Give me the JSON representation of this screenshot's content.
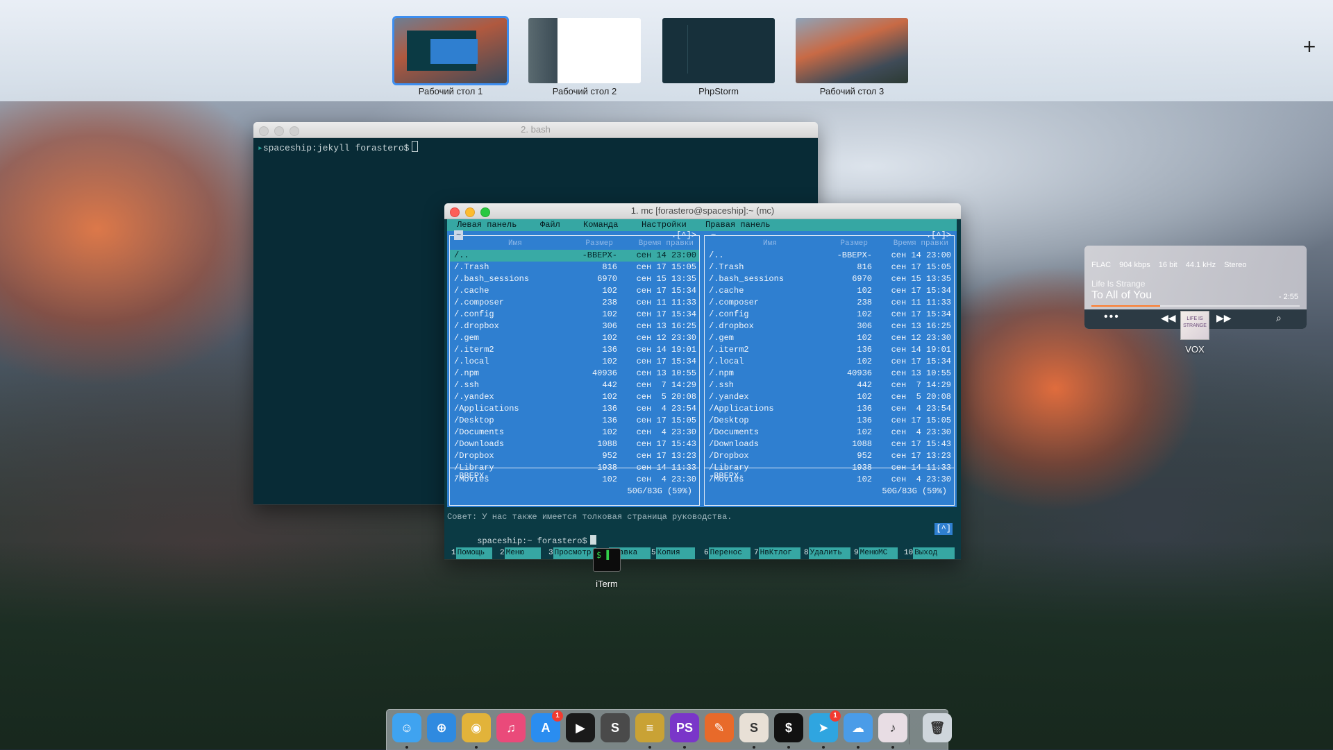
{
  "spaces": [
    {
      "label": "Рабочий стол 1",
      "active": true
    },
    {
      "label": "Рабочий стол 2",
      "active": false
    },
    {
      "label": "PhpStorm",
      "active": false
    },
    {
      "label": "Рабочий стол 3",
      "active": false
    }
  ],
  "add_space_label": "+",
  "bash_window": {
    "title": "2. bash",
    "prompt": "spaceship:jekyll forastero$"
  },
  "mc_window": {
    "title": "1. mc [forastero@spaceship]:~ (mc)",
    "menu": [
      "Левая панель",
      "Файл",
      "Команда",
      "Настройки",
      "Правая панель"
    ],
    "left_panel": {
      "path": "~",
      "header_right": ".[^]>",
      "columns": [
        "Имя",
        "Размер",
        "Время правки"
      ],
      "rows": [
        {
          "name": "/..",
          "size": "-ВВЕРХ-",
          "date": "сен 14 23:00",
          "selected": true
        },
        {
          "name": "/.Trash",
          "size": "816",
          "date": "сен 17 15:05"
        },
        {
          "name": "/.bash_sessions",
          "size": "6970",
          "date": "сен 15 13:35"
        },
        {
          "name": "/.cache",
          "size": "102",
          "date": "сен 17 15:34"
        },
        {
          "name": "/.composer",
          "size": "238",
          "date": "сен 11 11:33"
        },
        {
          "name": "/.config",
          "size": "102",
          "date": "сен 17 15:34"
        },
        {
          "name": "/.dropbox",
          "size": "306",
          "date": "сен 13 16:25"
        },
        {
          "name": "/.gem",
          "size": "102",
          "date": "сен 12 23:30"
        },
        {
          "name": "/.iterm2",
          "size": "136",
          "date": "сен 14 19:01"
        },
        {
          "name": "/.local",
          "size": "102",
          "date": "сен 17 15:34"
        },
        {
          "name": "/.npm",
          "size": "40936",
          "date": "сен 13 10:55"
        },
        {
          "name": "/.ssh",
          "size": "442",
          "date": "сен  7 14:29"
        },
        {
          "name": "/.yandex",
          "size": "102",
          "date": "сен  5 20:08"
        },
        {
          "name": "/Applications",
          "size": "136",
          "date": "сен  4 23:54"
        },
        {
          "name": "/Desktop",
          "size": "136",
          "date": "сен 17 15:05"
        },
        {
          "name": "/Documents",
          "size": "102",
          "date": "сен  4 23:30"
        },
        {
          "name": "/Downloads",
          "size": "1088",
          "date": "сен 17 15:43"
        },
        {
          "name": "/Dropbox",
          "size": "952",
          "date": "сен 17 13:23"
        },
        {
          "name": "/Library",
          "size": "1938",
          "date": "сен 14 11:33"
        },
        {
          "name": "/Movies",
          "size": "102",
          "date": "сен  4 23:30"
        }
      ],
      "status": "-ВВЕРХ-",
      "free": "50G/83G (59%)"
    },
    "right_panel": {
      "path": "~",
      "header_right": ".[^]>",
      "columns": [
        "Имя",
        "Размер",
        "Время правки"
      ],
      "rows": [
        {
          "name": "/..",
          "size": "-ВВЕРХ-",
          "date": "сен 14 23:00"
        },
        {
          "name": "/.Trash",
          "size": "816",
          "date": "сен 17 15:05"
        },
        {
          "name": "/.bash_sessions",
          "size": "6970",
          "date": "сен 15 13:35"
        },
        {
          "name": "/.cache",
          "size": "102",
          "date": "сен 17 15:34"
        },
        {
          "name": "/.composer",
          "size": "238",
          "date": "сен 11 11:33"
        },
        {
          "name": "/.config",
          "size": "102",
          "date": "сен 17 15:34"
        },
        {
          "name": "/.dropbox",
          "size": "306",
          "date": "сен 13 16:25"
        },
        {
          "name": "/.gem",
          "size": "102",
          "date": "сен 12 23:30"
        },
        {
          "name": "/.iterm2",
          "size": "136",
          "date": "сен 14 19:01"
        },
        {
          "name": "/.local",
          "size": "102",
          "date": "сен 17 15:34"
        },
        {
          "name": "/.npm",
          "size": "40936",
          "date": "сен 13 10:55"
        },
        {
          "name": "/.ssh",
          "size": "442",
          "date": "сен  7 14:29"
        },
        {
          "name": "/.yandex",
          "size": "102",
          "date": "сен  5 20:08"
        },
        {
          "name": "/Applications",
          "size": "136",
          "date": "сен  4 23:54"
        },
        {
          "name": "/Desktop",
          "size": "136",
          "date": "сен 17 15:05"
        },
        {
          "name": "/Documents",
          "size": "102",
          "date": "сен  4 23:30"
        },
        {
          "name": "/Downloads",
          "size": "1088",
          "date": "сен 17 15:43"
        },
        {
          "name": "/Dropbox",
          "size": "952",
          "date": "сен 17 13:23"
        },
        {
          "name": "/Library",
          "size": "1938",
          "date": "сен 14 11:33"
        },
        {
          "name": "/Movies",
          "size": "102",
          "date": "сен  4 23:30"
        }
      ],
      "status": "-ВВЕРХ-",
      "free": "50G/83G (59%)"
    },
    "hint": "Совет: У нас также имеется толковая страница руководства.",
    "prompt": "spaceship:~ forastero$",
    "prompt_right": "[^]",
    "fkeys": [
      {
        "num": "1",
        "label": "Помощь"
      },
      {
        "num": "2",
        "label": "Меню"
      },
      {
        "num": "3",
        "label": "Просмотр"
      },
      {
        "num": "4",
        "label": "Правка"
      },
      {
        "num": "5",
        "label": "Копия"
      },
      {
        "num": "6",
        "label": "Перенос"
      },
      {
        "num": "7",
        "label": "НвКтлог"
      },
      {
        "num": "8",
        "label": "Удалить"
      },
      {
        "num": "9",
        "label": "МенюМС"
      },
      {
        "num": "10",
        "label": "Выход"
      }
    ]
  },
  "iterm_hover": {
    "label": "iTerm",
    "icon_text": "$ ▌"
  },
  "vox": {
    "format": "FLAC",
    "bitrate": "904 kbps",
    "depth": "16 bit",
    "rate": "44.1 kHz",
    "channels": "Stereo",
    "album": "Life Is Strange",
    "track": "To All of You",
    "remaining": "- 2:55",
    "progress": 0.33,
    "label": "VOX",
    "cover_text": "LIFE IS STRANGE"
  },
  "dock": [
    {
      "name": "finder",
      "icon": "finder-icon",
      "color": "#3fa3f0",
      "glyph": "☺",
      "running": true
    },
    {
      "name": "safari",
      "icon": "safari-icon",
      "color": "#2f8ae0",
      "glyph": "⊕",
      "running": false
    },
    {
      "name": "chrome",
      "icon": "chrome-icon",
      "color": "#e2b33a",
      "glyph": "◉",
      "running": true
    },
    {
      "name": "itunes",
      "icon": "itunes-icon",
      "color": "#ea4a7a",
      "glyph": "♫",
      "running": false
    },
    {
      "name": "app-store",
      "icon": "app-store-icon",
      "color": "#2a8df0",
      "glyph": "A",
      "running": false,
      "badge": "1"
    },
    {
      "name": "quicktime",
      "icon": "quicktime-icon",
      "color": "#1a1a1a",
      "glyph": "▶",
      "running": false
    },
    {
      "name": "sublime",
      "icon": "sublime-icon",
      "color": "#4a4a4a",
      "glyph": "S",
      "running": false
    },
    {
      "name": "sequel",
      "icon": "database-icon",
      "color": "#c9a235",
      "glyph": "≡",
      "running": true
    },
    {
      "name": "phpstorm",
      "icon": "phpstorm-icon",
      "color": "#7a36c9",
      "glyph": "PS",
      "running": true
    },
    {
      "name": "tool",
      "icon": "wrench-icon",
      "color": "#e86a2a",
      "glyph": "✎",
      "running": false
    },
    {
      "name": "slack",
      "icon": "slack-icon",
      "color": "#e8e0d6",
      "glyph": "S",
      "running": true
    },
    {
      "name": "iterm",
      "icon": "iterm-icon",
      "color": "#111111",
      "glyph": "$",
      "running": true
    },
    {
      "name": "telegram",
      "icon": "telegram-icon",
      "color": "#2fa5e0",
      "glyph": "➤",
      "running": true,
      "badge": "1"
    },
    {
      "name": "cloud",
      "icon": "cloud-icon",
      "color": "#4a9ce8",
      "glyph": "☁",
      "running": true
    },
    {
      "name": "vox-app",
      "icon": "vox-album-icon",
      "color": "#e8dde4",
      "glyph": "♪",
      "running": true
    },
    {
      "name": "trash",
      "icon": "trash-icon",
      "color": "#cfd6dc",
      "glyph": "🗑",
      "running": false
    }
  ]
}
